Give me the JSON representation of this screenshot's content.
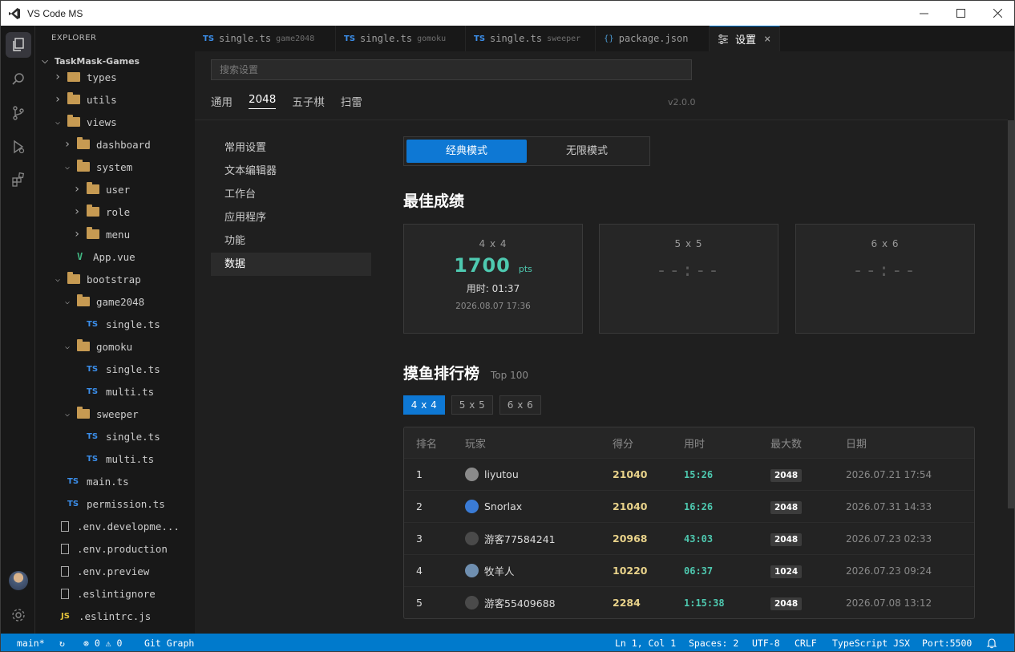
{
  "window": {
    "title": "VS Code MS"
  },
  "explorer": {
    "header": "EXPLORER",
    "root": "TaskMask-Games",
    "tree": [
      {
        "label": "types",
        "kind": "folder",
        "depth": 1,
        "open": false
      },
      {
        "label": "utils",
        "kind": "folder",
        "depth": 1,
        "open": false
      },
      {
        "label": "views",
        "kind": "folder",
        "depth": 1,
        "open": true
      },
      {
        "label": "dashboard",
        "kind": "folder",
        "depth": 2,
        "open": false
      },
      {
        "label": "system",
        "kind": "folder",
        "depth": 2,
        "open": true
      },
      {
        "label": "user",
        "kind": "folder",
        "depth": 3,
        "open": false
      },
      {
        "label": "role",
        "kind": "folder",
        "depth": 3,
        "open": false
      },
      {
        "label": "menu",
        "kind": "folder",
        "depth": 3,
        "open": false
      },
      {
        "label": "App.vue",
        "kind": "vue",
        "depth": 2
      },
      {
        "label": "bootstrap",
        "kind": "folder",
        "depth": 1,
        "open": true
      },
      {
        "label": "game2048",
        "kind": "folder",
        "depth": 2,
        "open": true
      },
      {
        "label": "single.ts",
        "kind": "ts",
        "depth": 3
      },
      {
        "label": "gomoku",
        "kind": "folder",
        "depth": 2,
        "open": true
      },
      {
        "label": "single.ts",
        "kind": "ts",
        "depth": 3
      },
      {
        "label": "multi.ts",
        "kind": "ts",
        "depth": 3
      },
      {
        "label": "sweeper",
        "kind": "folder",
        "depth": 2,
        "open": true
      },
      {
        "label": "single.ts",
        "kind": "ts",
        "depth": 3
      },
      {
        "label": "multi.ts",
        "kind": "ts",
        "depth": 3
      },
      {
        "label": "main.ts",
        "kind": "ts",
        "depth": 1
      },
      {
        "label": "permission.ts",
        "kind": "ts",
        "depth": 1
      },
      {
        "label": ".env.developme...",
        "kind": "file",
        "depth": 0
      },
      {
        "label": ".env.production",
        "kind": "file",
        "depth": 0
      },
      {
        "label": ".env.preview",
        "kind": "file",
        "depth": 0
      },
      {
        "label": ".eslintignore",
        "kind": "file",
        "depth": 0
      },
      {
        "label": ".eslintrc.js",
        "kind": "js",
        "depth": 0
      }
    ]
  },
  "tabs": [
    {
      "icon": "TS",
      "label": "single.ts",
      "desc": "game2048",
      "active": false
    },
    {
      "icon": "TS",
      "label": "single.ts",
      "desc": "gomoku",
      "active": false
    },
    {
      "icon": "TS",
      "label": "single.ts",
      "desc": "sweeper",
      "active": false
    },
    {
      "icon": "{}",
      "label": "package.json",
      "desc": "",
      "active": false
    },
    {
      "icon": "settings-icon",
      "label": "设置",
      "desc": "",
      "active": true
    }
  ],
  "settings": {
    "search_placeholder": "搜索设置",
    "nav_tabs": [
      "通用",
      "2048",
      "五子棋",
      "扫雷"
    ],
    "active_nav": "2048",
    "version": "v2.0.0",
    "left_nav": [
      "常用设置",
      "文本编辑器",
      "工作台",
      "应用程序",
      "功能",
      "数据"
    ],
    "active_left": "数据",
    "modes": [
      "经典模式",
      "无限模式"
    ],
    "active_mode": "经典模式",
    "best_title": "最佳成绩",
    "best": [
      {
        "size": "4 x 4",
        "score": "1700",
        "unit": "pts",
        "time": "用时: 01:37",
        "date": "2026.08.07 17:36"
      },
      {
        "size": "5 x 5",
        "empty": "--:--"
      },
      {
        "size": "6 x 6",
        "empty": "--:--"
      }
    ],
    "board_title": "摸鱼排行榜",
    "board_sub": "Top 100",
    "board_tabs": [
      "4 x 4",
      "5 x 5",
      "6 x 6"
    ],
    "active_board_tab": "4 x 4",
    "columns": [
      "排名",
      "玩家",
      "得分",
      "用时",
      "最大数",
      "日期"
    ],
    "rows": [
      {
        "rank": "1",
        "player": "liyutou",
        "score": "21040",
        "time": "15:26",
        "max": "2048",
        "date": "2026.07.21 17:54",
        "avatar": "#8a8a8a"
      },
      {
        "rank": "2",
        "player": "Snorlax",
        "score": "21040",
        "time": "16:26",
        "max": "2048",
        "date": "2026.07.31 14:33",
        "avatar": "#3a7bd5"
      },
      {
        "rank": "3",
        "player": "游客77584241",
        "score": "20968",
        "time": "43:03",
        "max": "2048",
        "date": "2026.07.23 02:33",
        "avatar": "#4a4a4a"
      },
      {
        "rank": "4",
        "player": "牧羊人",
        "score": "10220",
        "time": "06:37",
        "max": "1024",
        "date": "2026.07.23 09:24",
        "avatar": "#6f8fb0"
      },
      {
        "rank": "5",
        "player": "游客55409688",
        "score": "2284",
        "time": "1:15:38",
        "max": "2048",
        "date": "2026.07.08 13:12",
        "avatar": "#4a4a4a"
      }
    ]
  },
  "statusbar": {
    "branch": "main*",
    "sync": "↻",
    "problems": "⊗ 0 ⚠ 0",
    "gitgraph": "Git Graph",
    "position": "Ln 1, Col 1",
    "spaces": "Spaces: 2",
    "encoding": "UTF-8",
    "eol": "CRLF",
    "language": "TypeScript JSX",
    "port": "Port:5500"
  },
  "colors": {
    "accent": "#007acc",
    "score": "#4ec9b0",
    "gold": "#e8d28a"
  }
}
